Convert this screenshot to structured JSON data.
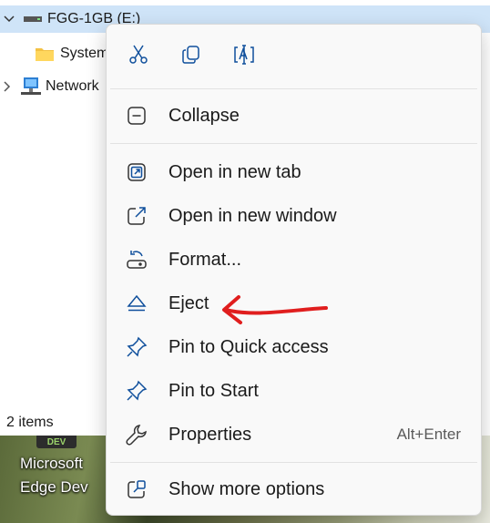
{
  "tree": {
    "drive_label": "FGG-1GB (E:)",
    "system_label": "System",
    "network_label": "Network"
  },
  "status": {
    "items_text": "2 items"
  },
  "desktop": {
    "badge": "DEV",
    "icon_label_line1": "Microsoft",
    "icon_label_line2": "Edge Dev"
  },
  "menu": {
    "toolbar": [
      {
        "name": "cut-icon"
      },
      {
        "name": "copy-icon"
      },
      {
        "name": "rename-icon"
      }
    ],
    "items": [
      {
        "label": "Collapse",
        "icon": "collapse-icon"
      },
      {
        "label": "Open in new tab",
        "icon": "new-tab-icon"
      },
      {
        "label": "Open in new window",
        "icon": "new-window-icon"
      },
      {
        "label": "Format...",
        "icon": "format-icon"
      },
      {
        "label": "Eject",
        "icon": "eject-icon"
      },
      {
        "label": "Pin to Quick access",
        "icon": "pin-icon"
      },
      {
        "label": "Pin to Start",
        "icon": "pin-icon"
      },
      {
        "label": "Properties",
        "icon": "wrench-icon",
        "shortcut": "Alt+Enter"
      },
      {
        "label": "Show more options",
        "icon": "more-options-icon"
      }
    ]
  },
  "colors": {
    "accent": "#0067c0",
    "selection": "#cfe4f8",
    "annotation_arrow": "#e01e1e"
  }
}
